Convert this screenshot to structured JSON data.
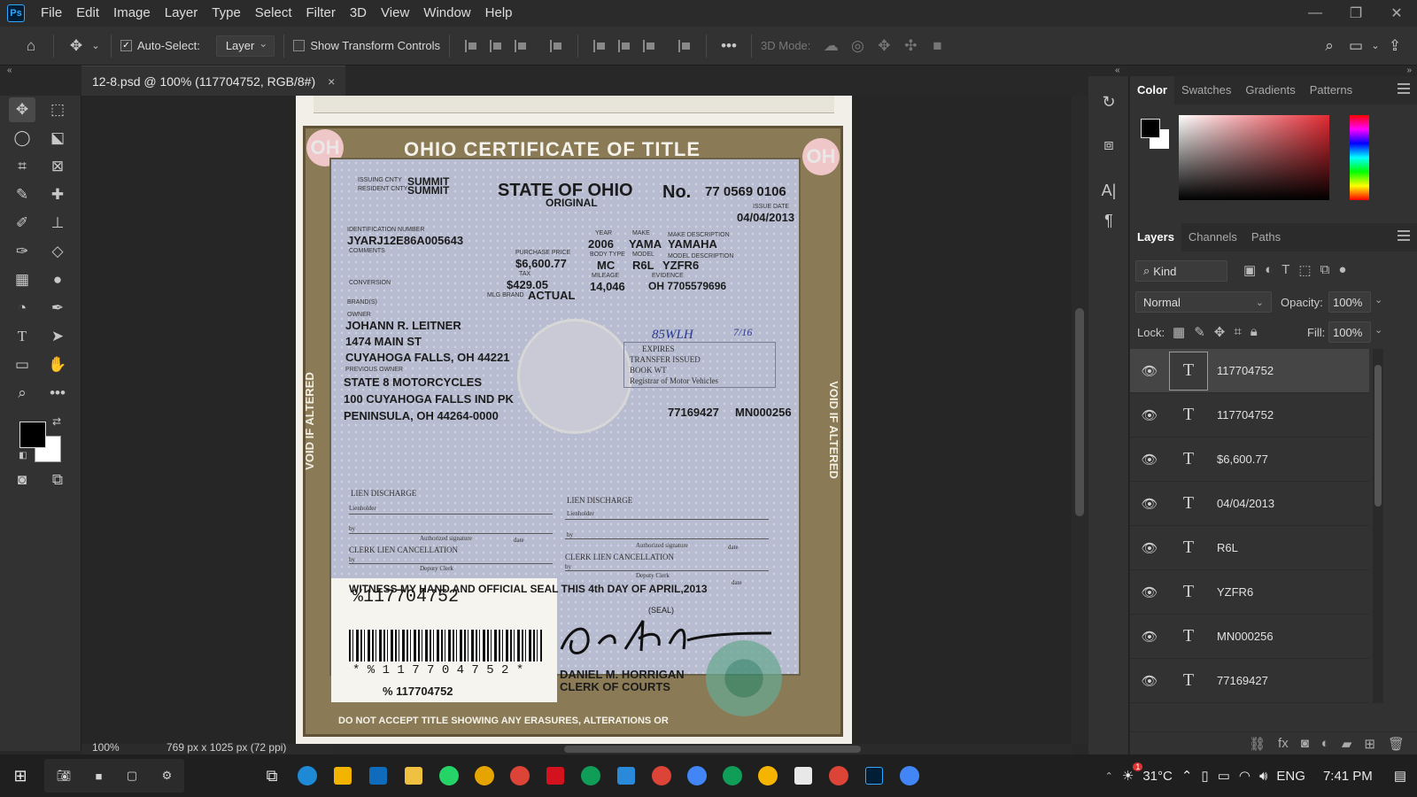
{
  "menubar": {
    "app_icon": "Ps",
    "items": [
      "File",
      "Edit",
      "Image",
      "Layer",
      "Type",
      "Select",
      "Filter",
      "3D",
      "View",
      "Window",
      "Help"
    ]
  },
  "options": {
    "auto_select_label": "Auto-Select:",
    "auto_select_value": "Layer",
    "show_transform_label": "Show Transform Controls",
    "mode_label": "3D Mode:"
  },
  "tab": {
    "title": "12-8.psd @ 100% (117704752, RGB/8#)",
    "close": "×"
  },
  "status": {
    "zoom": "100%",
    "dimensions": "769 px x 1025 px (72 ppi)"
  },
  "document": {
    "header_title": "OHIO CERTIFICATE OF TITLE",
    "oh": "OH",
    "issuing_county_label": "ISSUING CNTY",
    "issuing_county": "SUMMIT",
    "resident_county_label": "RESIDENT CNTY",
    "resident_county": "SUMMIT",
    "state": "STATE OF OHIO",
    "original": "ORIGINAL",
    "no_label": "No.",
    "title_no": "77 0569 0106",
    "issue_date_label": "ISSUE DATE",
    "issue_date": "04/04/2013",
    "id_label": "IDENTIFICATION NUMBER",
    "vin": "JYARJ12E86A005643",
    "comments_label": "COMMENTS",
    "year_label": "YEAR",
    "year": "2006",
    "make_label": "MAKE",
    "make": "YAMA",
    "make_desc_label": "MAKE DESCRIPTION",
    "make_desc": "YAMAHA",
    "purchase_label": "PURCHASE PRICE",
    "purchase_price": "$6,600.77",
    "body_label": "BODY TYPE",
    "body_type": "MC",
    "model_label": "MODEL",
    "model": "R6L",
    "model_desc_label": "MODEL DESCRIPTION",
    "model_desc": "YZFR6",
    "conversion_label": "CONVERSION",
    "tax_label": "TAX",
    "tax": "$429.05",
    "mileage_label": "MILEAGE",
    "mileage": "14,046",
    "evidence_label": "EVIDENCE",
    "evidence": "OH 7705579696",
    "mlg_brand_label": "MLG BRAND",
    "mlg_brand": "ACTUAL",
    "brands_label": "BRAND(S)",
    "owner_label": "OWNER",
    "owner_name": "JOHANN R. LEITNER",
    "owner_street": "1474 MAIN ST",
    "owner_city": "CUYAHOGA FALLS, OH 44221",
    "prev_owner_label": "PREVIOUS OWNER",
    "prev_name": "STATE 8 MOTORCYCLES",
    "prev_street": "100 CUYAHOGA FALLS IND PK",
    "prev_city": "PENINSULA, OH 44264-0000",
    "ref_1": "77169427",
    "ref_2": "MN000256",
    "handwriting": "85WLH",
    "handwriting_date": "7/16",
    "transfer_lines": [
      "EXPIRES",
      "TRANSFER ISSUED",
      "BOOK WT",
      "Registrar of Motor Vehicles"
    ],
    "void_text": "VOID IF ALTERED",
    "lien_discharge": "LIEN DISCHARGE",
    "lienholder": "Lienholder",
    "by": "by",
    "authorized_signature": "Authorized signature",
    "date": "date",
    "clerk_lien": "CLERK LIEN CANCELLATION",
    "deputy_clerk": "Deputy Clerk",
    "witness": "WITNESS MY HAND AND OFFICIAL SEAL THIS 4th DAY OF APRIL,2013",
    "seal_label": "(SEAL)",
    "barcode_top": "%117704752",
    "barcode_text": "* % 1 1 7 7 0 4 7 5 2 *",
    "barcode_bottom": "% 117704752",
    "clerk_name": "DANIEL M. HORRIGAN",
    "clerk_title": "CLERK OF COURTS",
    "footer": "DO NOT ACCEPT TITLE SHOWING ANY ERASURES, ALTERATIONS OR"
  },
  "color_panel": {
    "tabs": [
      "Color",
      "Swatches",
      "Gradients",
      "Patterns"
    ]
  },
  "layers_panel": {
    "tabs": [
      "Layers",
      "Channels",
      "Paths"
    ],
    "kind": "Kind",
    "blend_mode": "Normal",
    "opacity_label": "Opacity:",
    "opacity": "100%",
    "lock_label": "Lock:",
    "fill_label": "Fill:",
    "fill": "100%",
    "layers": [
      {
        "name": "117704752",
        "thumb": "T",
        "selected": true
      },
      {
        "name": "117704752",
        "thumb": "T",
        "selected": false
      },
      {
        "name": "$6,600.77",
        "thumb": "T",
        "selected": false
      },
      {
        "name": "04/04/2013",
        "thumb": "T",
        "selected": false
      },
      {
        "name": "R6L",
        "thumb": "T",
        "selected": false
      },
      {
        "name": "YZFR6",
        "thumb": "T",
        "selected": false
      },
      {
        "name": "MN000256",
        "thumb": "T",
        "selected": false
      },
      {
        "name": "77169427",
        "thumb": "T",
        "selected": false
      }
    ]
  },
  "taskbar": {
    "weather_temp": "31°C",
    "weather_badge": "1",
    "language": "ENG",
    "time": "7:41 PM"
  }
}
